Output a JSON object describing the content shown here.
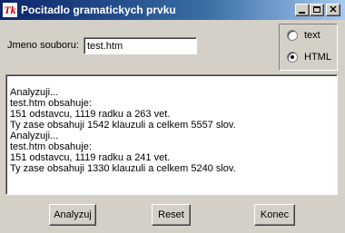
{
  "window": {
    "icon": "tk-icon",
    "title": "Pocitadlo gramatickych prvku"
  },
  "form": {
    "file_label": "Jmeno souboru:",
    "file_value": "test.htm"
  },
  "format": {
    "options": [
      "text",
      "HTML"
    ],
    "selected": "HTML"
  },
  "output": {
    "lines": [
      "Analyzuji...",
      "test.htm obsahuje:",
      "151 odstavcu, 1119 radku a 263 vet.",
      "Ty zase obsahuji 1542 klauzuli a celkem 5557 slov.",
      "Analyzuji...",
      "test.htm obsahuje:",
      "151 odstavcu, 1119 radku a 241 vet.",
      "Ty zase obsahuji 1330 klauzuli a celkem 5240 slov."
    ]
  },
  "buttons": {
    "analyze": "Analyzuj",
    "reset": "Reset",
    "quit": "Konec"
  }
}
